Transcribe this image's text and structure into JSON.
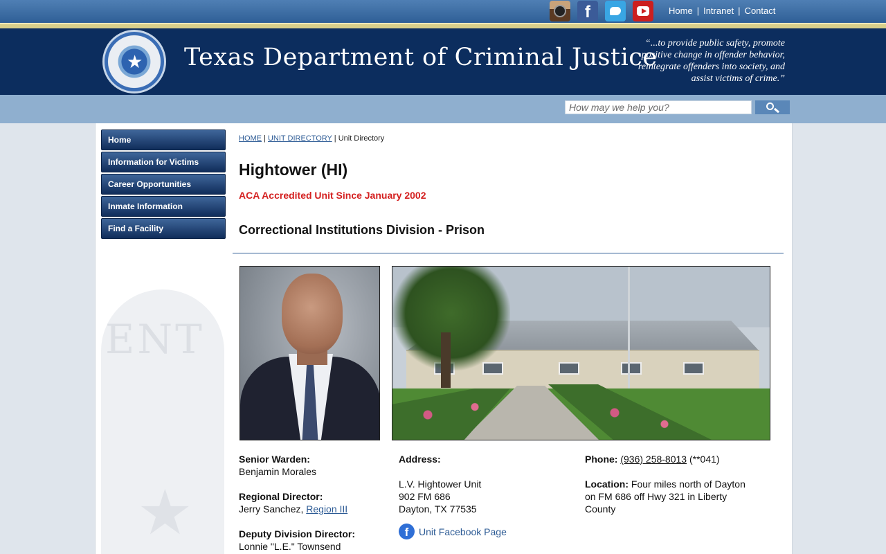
{
  "top_links": [
    "Home",
    "Intranet",
    "Contact"
  ],
  "social": [
    "instagram-icon",
    "facebook-icon",
    "twitter-icon",
    "youtube-icon"
  ],
  "header": {
    "title": "Texas Department of Criminal Justice",
    "mission": "“...to provide public safety, promote positive change in offender behavior, reintegrate offenders into society, and assist victims of crime.”"
  },
  "search": {
    "placeholder": "How may we help you?"
  },
  "nav": [
    "Home",
    "Information for Victims",
    "Career Opportunities",
    "Inmate Information",
    "Find a Facility"
  ],
  "breadcrumb": {
    "home": "HOME",
    "unit_directory": "UNIT DIRECTORY",
    "current": "Unit Directory"
  },
  "unit": {
    "name": "Hightower (HI)",
    "accreditation": "ACA Accredited Unit Since January 2002",
    "division": "Correctional Institutions Division - Prison"
  },
  "contacts": {
    "senior_warden_label": "Senior Warden:",
    "senior_warden": "Benjamin Morales",
    "regional_director_label": "Regional Director:",
    "regional_director": "Jerry Sanchez,",
    "region_link": "Region III",
    "deputy_director_label": "Deputy Division Director:",
    "deputy_director": "Lonnie \"L.E.\" Townsend"
  },
  "address": {
    "label": "Address:",
    "line1": "L.V. Hightower Unit",
    "line2": "902 FM 686",
    "line3": "Dayton, TX 77535",
    "facebook_link": "Unit Facebook Page"
  },
  "phone": {
    "label": "Phone:",
    "number": "(936) 258-8013",
    "ext": "(**041)",
    "location_label": "Location:",
    "location": "Four miles north of Dayton on FM 686 off Hwy 321 in Liberty County"
  },
  "colors": {
    "header_navy": "#0c2d5e",
    "accent_red": "#d42020",
    "link_blue": "#2d5b95"
  }
}
